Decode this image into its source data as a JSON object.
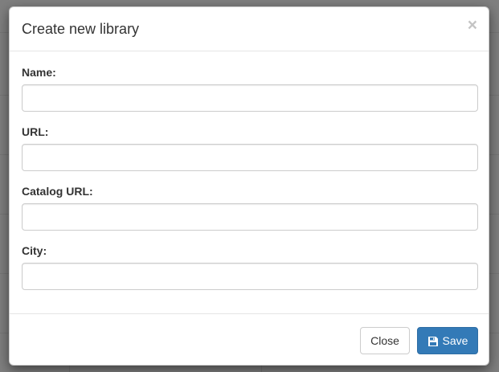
{
  "modal": {
    "title": "Create new library",
    "close_glyph": "×"
  },
  "form": {
    "fields": [
      {
        "label": "Name:",
        "value": "",
        "placeholder": ""
      },
      {
        "label": "URL:",
        "value": "",
        "placeholder": ""
      },
      {
        "label": "Catalog URL:",
        "value": "",
        "placeholder": ""
      },
      {
        "label": "City:",
        "value": "",
        "placeholder": ""
      }
    ]
  },
  "footer": {
    "close_label": "Close",
    "save_label": "Save",
    "save_icon": "floppy-disk-icon"
  },
  "colors": {
    "primary": "#337ab7",
    "backdrop": "#7f7f7f"
  }
}
